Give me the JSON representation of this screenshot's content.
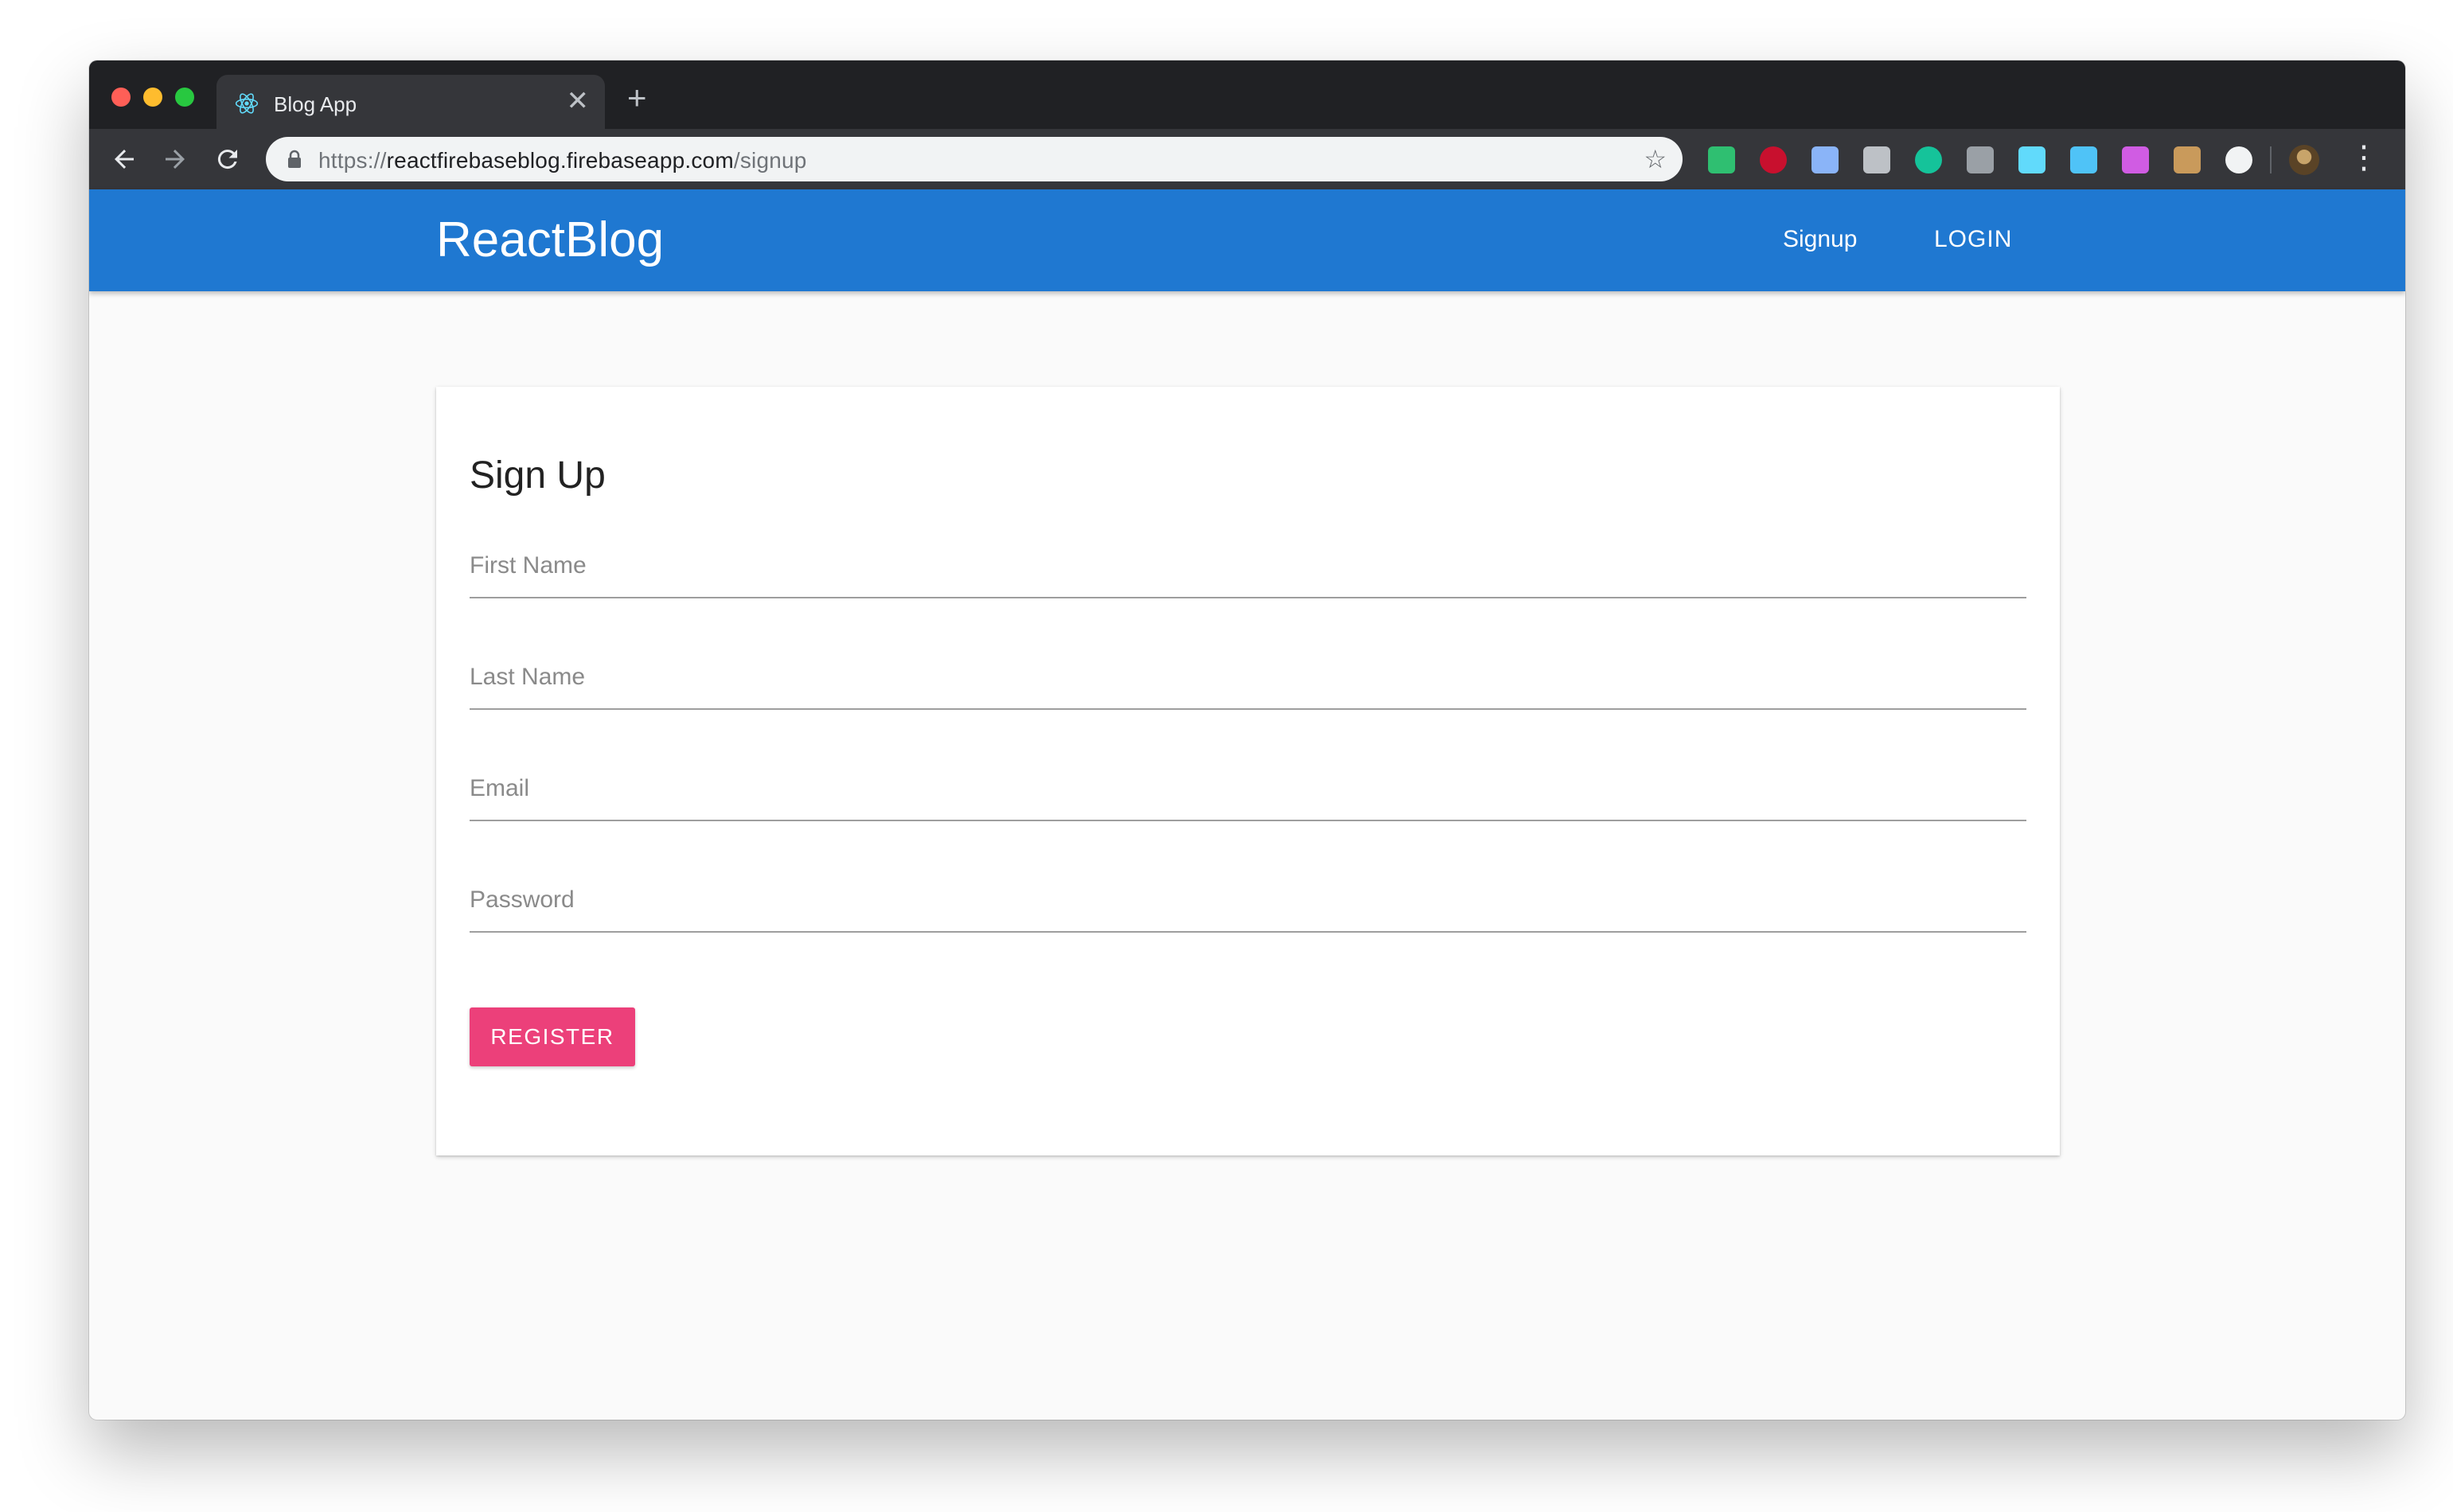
{
  "browser": {
    "tab_title": "Blog App",
    "tab_close_glyph": "✕",
    "new_tab_glyph": "+",
    "url_scheme": "https://",
    "url_host": "reactfirebaseblog.firebaseapp.com",
    "url_path": "/signup",
    "extensions": [
      {
        "icon": "shield-icon",
        "color": "#2fbf71"
      },
      {
        "icon": "abp-icon",
        "color": "#c8102e"
      },
      {
        "icon": "gear-network-icon",
        "color": "#8ab4f8"
      },
      {
        "icon": "camera-icon",
        "color": "#bdc1c6"
      },
      {
        "icon": "grammarly-icon",
        "color": "#15c39a"
      },
      {
        "icon": "translate-icon",
        "color": "#9aa0a6"
      },
      {
        "icon": "react-icon",
        "color": "#61dafb"
      },
      {
        "icon": "eyedropper-icon",
        "color": "#4fc3f7"
      },
      {
        "icon": "broadcast-icon",
        "color": "#d05ce3"
      },
      {
        "icon": "box-icon",
        "color": "#c99a5b"
      },
      {
        "icon": "circle-icon",
        "color": "#f1f3f4"
      }
    ]
  },
  "app": {
    "brand": "ReactBlog",
    "nav": {
      "signup": "Signup",
      "login": "LOGIN"
    },
    "primary_color": "#1f78d1",
    "accent_color": "#ec407a"
  },
  "form": {
    "title": "Sign Up",
    "first_name_placeholder": "First Name",
    "last_name_placeholder": "Last Name",
    "email_placeholder": "Email",
    "password_placeholder": "Password",
    "register_label": "REGISTER"
  }
}
